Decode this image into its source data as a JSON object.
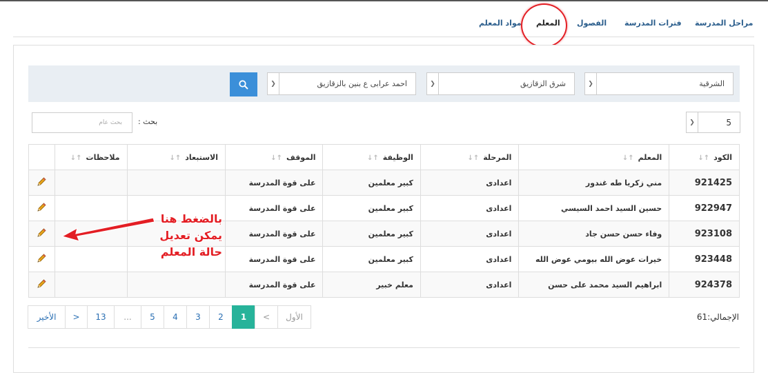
{
  "tabs": [
    {
      "label": "مراحل المدرسة",
      "active": false
    },
    {
      "label": "فترات المدرسة",
      "active": false
    },
    {
      "label": "الفصول",
      "active": false
    },
    {
      "label": "المعلم",
      "active": true
    },
    {
      "label": "مواد المعلم",
      "active": false
    }
  ],
  "filters": {
    "governorate": "الشرقية",
    "district": "شرق الزقازيق",
    "school": "احمد عرابى ع بنين بالزقازيق"
  },
  "page_length": "5",
  "search": {
    "label": "بحث :",
    "placeholder": "بحث عام"
  },
  "table": {
    "headers": [
      "الكود",
      "المعلم",
      "المرحلة",
      "الوظيفة",
      "الموقف",
      "الاستبعاد",
      "ملاحظات",
      ""
    ],
    "rows": [
      {
        "code": "921425",
        "teacher": "مني زكريا طه غندور",
        "stage": "اعدادى",
        "job": "كبير معلمين",
        "status": "على قوة المدرسة",
        "exclusion": "",
        "notes": ""
      },
      {
        "code": "922947",
        "teacher": "حسين السيد احمد السيسي",
        "stage": "اعدادى",
        "job": "كبير معلمين",
        "status": "على قوة المدرسة",
        "exclusion": "",
        "notes": ""
      },
      {
        "code": "923108",
        "teacher": "وفاء حسن حسن جاد",
        "stage": "اعدادى",
        "job": "كبير معلمين",
        "status": "على قوة المدرسة",
        "exclusion": "",
        "notes": ""
      },
      {
        "code": "923448",
        "teacher": "خيرات عوض الله بيومي عوض الله",
        "stage": "اعدادى",
        "job": "كبير معلمين",
        "status": "على قوة المدرسة",
        "exclusion": "",
        "notes": ""
      },
      {
        "code": "924378",
        "teacher": "ابراهيم السيد محمد على حسن",
        "stage": "اعدادى",
        "job": "معلم خبير",
        "status": "على قوة المدرسة",
        "exclusion": "",
        "notes": ""
      }
    ]
  },
  "pagination": {
    "first": "الأول",
    "prev": "<",
    "pages": [
      "1",
      "2",
      "3",
      "4",
      "5",
      "...",
      "13"
    ],
    "active_page": "1",
    "next": ">",
    "last": "الأخير"
  },
  "total": "الإجمالي:61",
  "annotation": {
    "line1": "بالضغط هنا",
    "line2": "يمكن تعديل",
    "line3": "حالة المعلم"
  },
  "colors": {
    "accent": "#3b8fd9",
    "active_page": "#27b39a",
    "annotation": "#e31e24",
    "link": "#2a6fb3"
  }
}
